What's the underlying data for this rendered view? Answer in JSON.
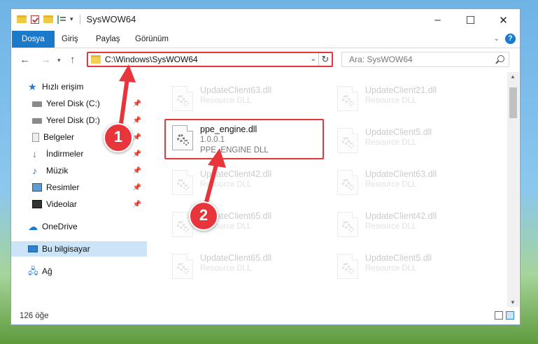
{
  "window": {
    "title": "SysWOW64"
  },
  "ribbon": {
    "tabs": [
      "Dosya",
      "Giriş",
      "Paylaş",
      "Görünüm"
    ]
  },
  "navbar": {
    "address": "C:\\Windows\\SysWOW64",
    "search_placeholder": "Ara: SysWOW64"
  },
  "sidebar": {
    "items": [
      {
        "label": "Hızlı erişim",
        "icon": "star-icon"
      },
      {
        "label": "Yerel Disk (C:)",
        "icon": "drive-icon"
      },
      {
        "label": "Yerel Disk (D:)",
        "icon": "drive-icon"
      },
      {
        "label": "Belgeler",
        "icon": "documents-icon"
      },
      {
        "label": "İndirmeler",
        "icon": "downloads-icon"
      },
      {
        "label": "Müzik",
        "icon": "music-icon"
      },
      {
        "label": "Resimler",
        "icon": "pictures-icon"
      },
      {
        "label": "Videolar",
        "icon": "videos-icon"
      },
      {
        "label": "OneDrive",
        "icon": "cloud-icon"
      },
      {
        "label": "Bu bilgisayar",
        "icon": "computer-icon"
      },
      {
        "label": "Ağ",
        "icon": "network-icon"
      }
    ]
  },
  "files": {
    "highlighted": {
      "name": "ppe_engine.dll",
      "version": "1.0.0.1",
      "description": "PPE_ENGINE DLL"
    },
    "background": [
      {
        "name": "UpdateClient63.dll",
        "desc": "Resource DLL"
      },
      {
        "name": "UpdateClient21.dll",
        "desc": "Resource DLL"
      },
      {
        "name": "UpdateClient5.dll",
        "desc": "Resource DLL"
      },
      {
        "name": "UpdateClient42.dll",
        "desc": "Resource DLL"
      },
      {
        "name": "UpdateClient63.dll",
        "desc": "Resource DLL"
      },
      {
        "name": "UpdateClient65.dll",
        "desc": "Resource DLL"
      },
      {
        "name": "UpdateClient42.dll",
        "desc": "Resource DLL"
      },
      {
        "name": "UpdateClient65.dll",
        "desc": "Resource DLL"
      },
      {
        "name": "UpdateClient5.dll",
        "desc": "Resource DLL"
      }
    ]
  },
  "status": {
    "item_count": "126 öğe"
  },
  "annotations": {
    "step1": "1",
    "step2": "2",
    "color": "#e8343b"
  }
}
